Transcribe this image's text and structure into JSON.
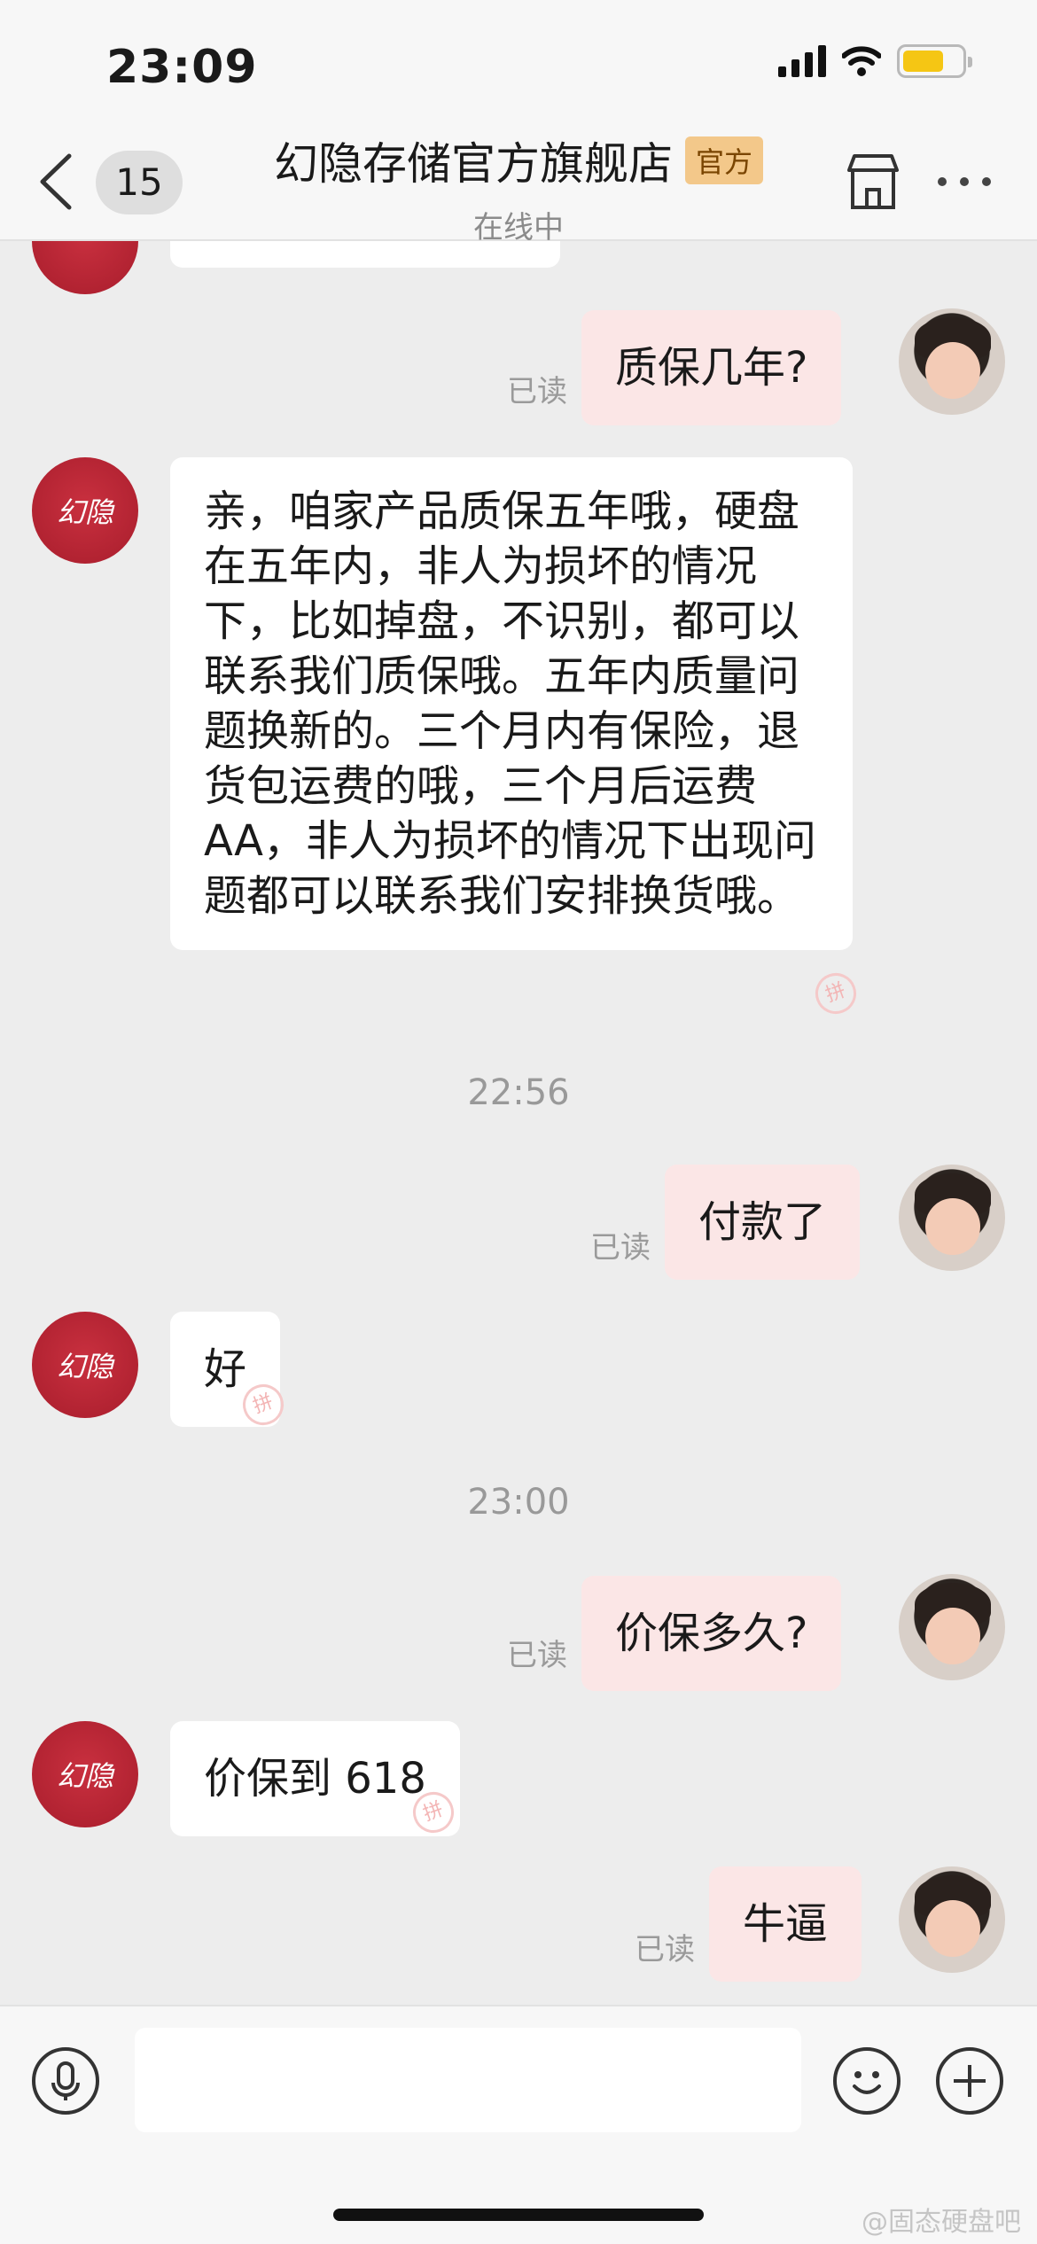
{
  "status_bar": {
    "time": "23:09"
  },
  "header": {
    "unread_count": "15",
    "shop_name": "幻隐存储官方旗舰店",
    "official_badge": "官方",
    "online_status": "在线中"
  },
  "shop_avatar_text": "幻隐",
  "messages": {
    "m1": {
      "text": "质保几年?",
      "read": "已读"
    },
    "m2": {
      "text": "亲，咱家产品质保五年哦，硬盘在五年内，非人为损坏的情况下，比如掉盘，不识别，都可以联系我们质保哦。五年内质量问题换新的。三个月内有保险，退货包运费的哦，三个月后运费AA，非人为损坏的情况下出现问题都可以联系我们安排换货哦。"
    },
    "t1": "22:56",
    "m3": {
      "text": "付款了",
      "read": "已读"
    },
    "m4": {
      "text": "好"
    },
    "t2": "23:00",
    "m5": {
      "text": "价保多久?",
      "read": "已读"
    },
    "m6": {
      "text": "价保到 618"
    },
    "m7": {
      "text": "牛逼",
      "read": "已读"
    }
  },
  "stamp_char": "拼",
  "input": {
    "placeholder": ""
  },
  "watermark": "@固态硬盘吧",
  "colors": {
    "shop_avatar": "#b3202f",
    "out_bubble": "#fbe6e6",
    "battery": "#f5c614"
  }
}
